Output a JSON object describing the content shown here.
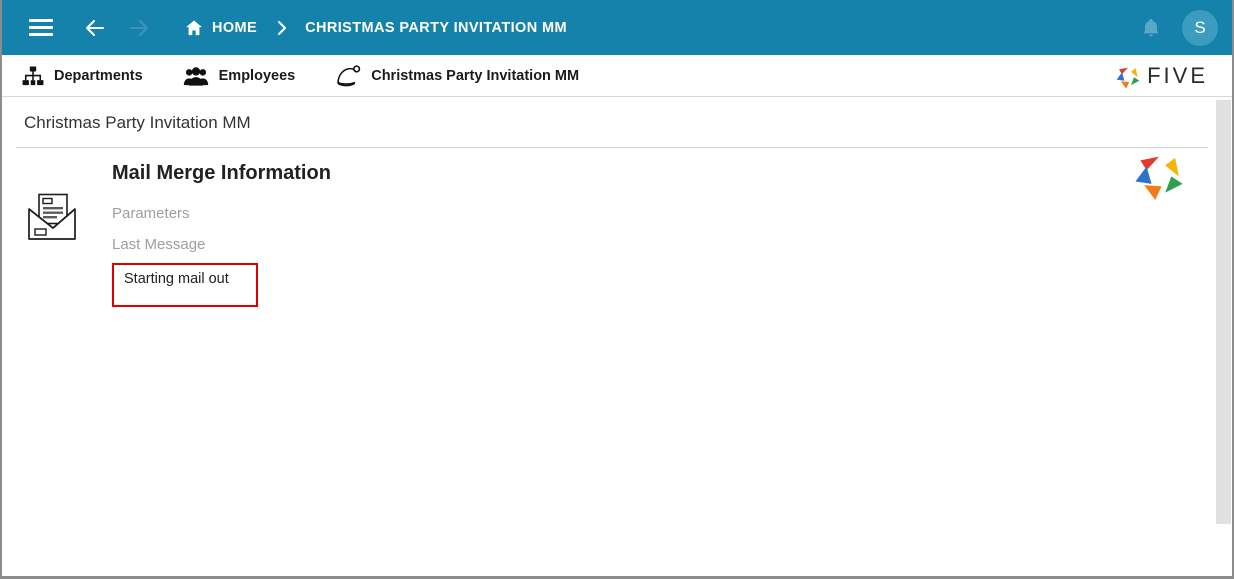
{
  "topbar": {
    "menu_icon": "hamburger-menu-icon",
    "back_icon": "arrow-left-icon",
    "forward_icon": "arrow-right-icon",
    "home_icon": "home-icon",
    "home_label": "HOME",
    "breadcrumb_separator": "chevron-right-icon",
    "current_crumb": "CHRISTMAS PARTY INVITATION MM",
    "notification_icon": "bell-icon",
    "avatar_initial": "S",
    "background_color": "#1482ab"
  },
  "tabs": [
    {
      "label": "Departments",
      "icon": "sitemap-icon"
    },
    {
      "label": "Employees",
      "icon": "users-group-icon"
    },
    {
      "label": "Christmas Party Invitation MM",
      "icon": "santa-hat-icon"
    }
  ],
  "brand": {
    "logo_icon": "five-pinwheel-logo-icon",
    "text": "FIVE"
  },
  "page": {
    "title": "Christmas Party Invitation MM",
    "record_icon": "open-envelope-mail-icon",
    "section_heading": "Mail Merge Information",
    "fields": [
      {
        "label": "Parameters",
        "value": ""
      },
      {
        "label": "Last Message",
        "value": "Starting mail out"
      }
    ],
    "highlight_color": "#e00000",
    "watermark_icon": "five-pinwheel-logo-icon"
  },
  "scrollbar": {
    "orientation": "vertical",
    "thumb_color": "#e1e1e1"
  }
}
